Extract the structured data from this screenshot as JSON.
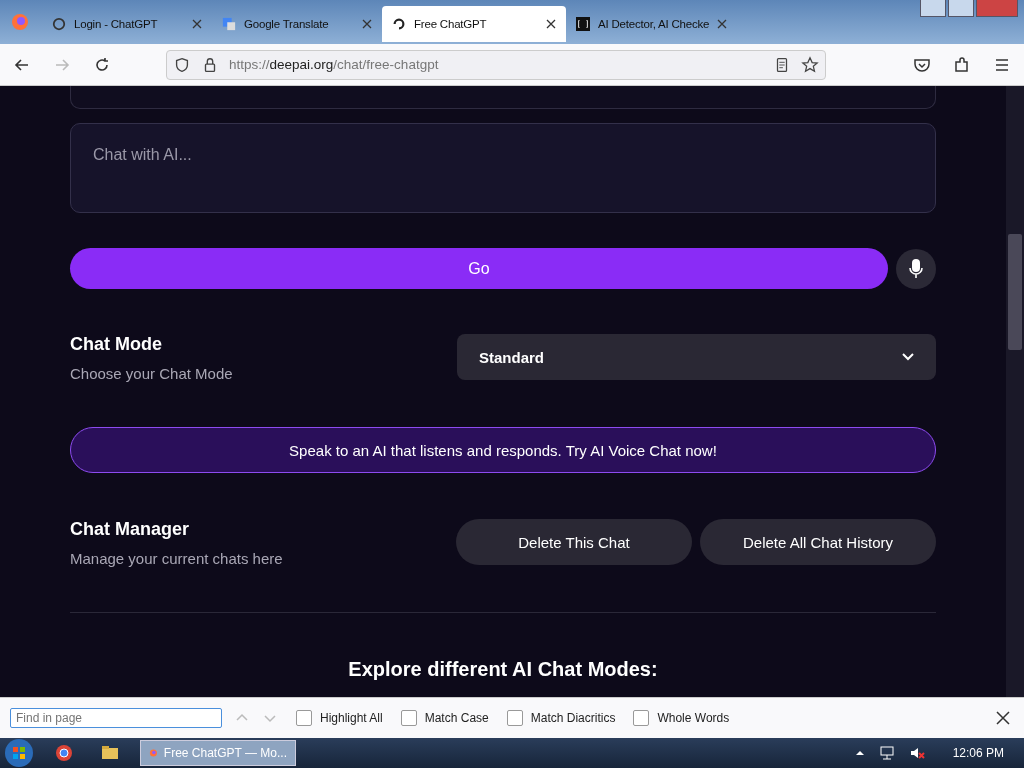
{
  "browser": {
    "tabs": [
      {
        "title": "Login - ChatGPT",
        "selected": false
      },
      {
        "title": "Google Translate",
        "selected": false
      },
      {
        "title": "Free ChatGPT",
        "selected": true
      },
      {
        "title": "AI Detector, AI Checke",
        "selected": false
      }
    ],
    "url": {
      "scheme": "https://",
      "host": "deepai.org",
      "path": "/chat/free-chatgpt"
    }
  },
  "page": {
    "chat_input": {
      "placeholder": "Chat with AI..."
    },
    "go_button": "Go",
    "chat_mode": {
      "title": "Chat Mode",
      "subtitle": "Choose your Chat Mode",
      "value": "Standard"
    },
    "voice_banner": "Speak to an AI that listens and responds. Try AI Voice Chat now!",
    "chat_manager": {
      "title": "Chat Manager",
      "subtitle": "Manage your current chats here",
      "buttons": [
        "Delete This Chat",
        "Delete All Chat History"
      ]
    },
    "explore_heading": "Explore different AI Chat Modes:"
  },
  "find_bar": {
    "placeholder": "Find in page",
    "options": [
      {
        "label": "Highlight All",
        "checked": false
      },
      {
        "label": "Match Case",
        "checked": false
      },
      {
        "label": "Match Diacritics",
        "checked": false
      },
      {
        "label": "Whole Words",
        "checked": false
      }
    ]
  },
  "taskbar": {
    "window": "Free ChatGPT — Mo...",
    "clock": "12:06 PM"
  }
}
